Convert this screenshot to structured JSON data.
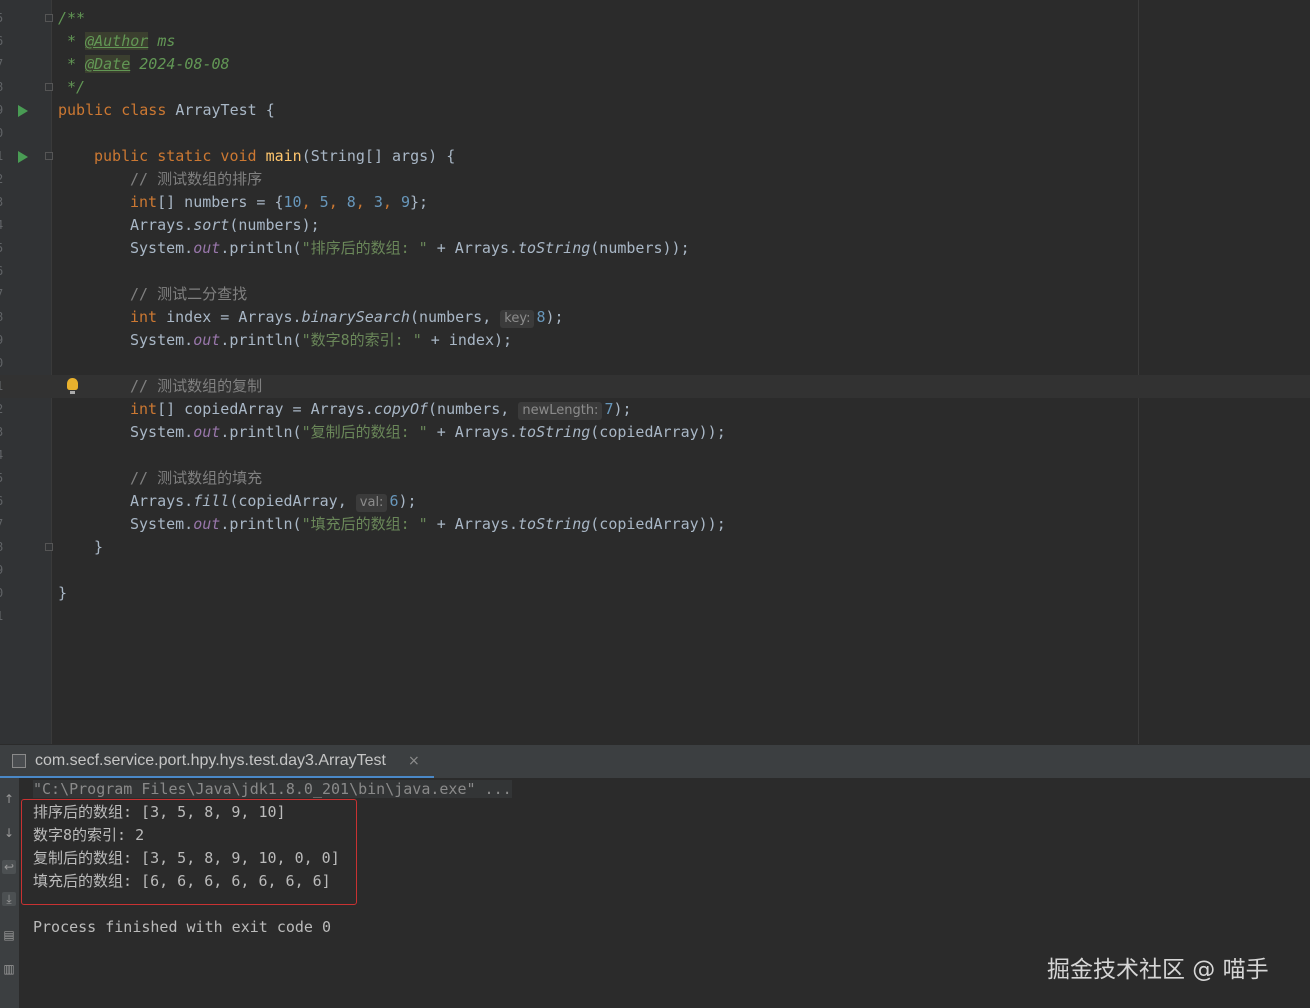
{
  "editor": {
    "line_numbers": [
      "5",
      "6",
      "7",
      "8",
      "9",
      "0",
      "1",
      "2",
      "3",
      "4",
      "5",
      "6",
      "7",
      "8",
      "9",
      "0",
      "1",
      "2",
      "3",
      "4",
      "5",
      "6",
      "7",
      "8",
      "9",
      "0",
      "1"
    ],
    "code": {
      "l1": "/**",
      "l2_star": " * ",
      "l2_tag": "@Author",
      "l2_val": " ms",
      "l3_star": " * ",
      "l3_tag": "@Date",
      "l3_val": " 2024-08-08",
      "l4": " */",
      "l5_kw": "public class ",
      "l5_rest": "ArrayTest {",
      "l7_kw": "public static void ",
      "l7_mth": "main",
      "l7_rest": "(String[] args) {",
      "c1": "// 测试数组的排序",
      "l9_kw": "int",
      "l9_a": "[] numbers = {",
      "n10": "10",
      "n5": "5",
      "n8": "8",
      "n3": "3",
      "n9": "9",
      "comma": ", ",
      "l9_end": "};",
      "arrays": "Arrays.",
      "sort": "sort",
      "l10_rest": "(numbers);",
      "system": "System.",
      "out": "out",
      "println": ".println(",
      "s1": "\"排序后的数组: \"",
      "plus_arrays": " + Arrays.",
      "tostring": "toString",
      "l11_end": "(numbers));",
      "c2": "// 测试二分查找",
      "l14_a": " index = Arrays.",
      "binsearch": "binarySearch",
      "l14_b": "(numbers, ",
      "hint_key": "key:",
      "n8b": "8",
      "l14_end": ");",
      "s2": "\"数字8的索引: \"",
      "l15_end": " + index);",
      "c3": "// 测试数组的复制",
      "l17_a": "[] copiedArray = Arrays.",
      "copyof": "copyOf",
      "hint_newlength": "newLength:",
      "n7": "7",
      "s3": "\"复制后的数组: \"",
      "copied_end": "(copiedArray));",
      "c4": "// 测试数组的填充",
      "fill": "fill",
      "l21_b": "(copiedArray, ",
      "hint_val": "val:",
      "n6": "6",
      "s4": "\"填充后的数组: \"",
      "close_method": "}",
      "close_class": "}"
    }
  },
  "run_panel": {
    "tab_title": "com.secf.service.port.hpy.hys.test.day3.ArrayTest",
    "tab_close": "×"
  },
  "console": {
    "command": "\"C:\\Program Files\\Java\\jdk1.8.0_201\\bin\\java.exe\" ...",
    "lines": [
      "排序后的数组: [3, 5, 8, 9, 10]",
      "数字8的索引: 2",
      "复制后的数组: [3, 5, 8, 9, 10, 0, 0]",
      "填充后的数组: [6, 6, 6, 6, 6, 6, 6]"
    ],
    "finished": "Process finished with exit code 0"
  },
  "side_icons": [
    "up-arrow-icon",
    "down-arrow-icon",
    "soft-wrap-icon",
    "scroll-to-end-icon",
    "print-icon",
    "trash-icon"
  ],
  "watermark": "掘金技术社区 @ 喵手",
  "colors": {
    "keyword": "#cc7832",
    "string": "#6a8759",
    "number": "#6897bb",
    "comment": "#808080",
    "field": "#9876aa",
    "highlight_box": "#c83232"
  }
}
